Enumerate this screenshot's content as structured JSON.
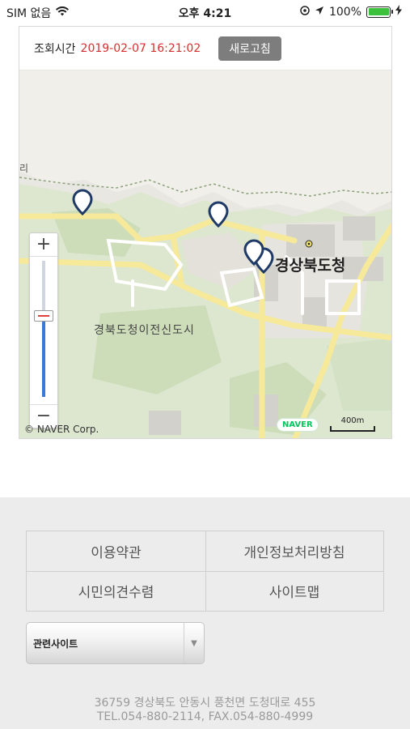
{
  "status_bar": {
    "carrier": "SIM 없음",
    "time": "오후 4:21",
    "battery": "100%",
    "icons": [
      "wifi-icon",
      "location-lock-icon",
      "location-arrow-icon",
      "battery-icon",
      "charging-icon"
    ]
  },
  "map_card": {
    "query_label": "조회시간",
    "query_time": "2019-02-07 16:21:02",
    "refresh_label": "새로고침",
    "map": {
      "big_label": "경상북도청",
      "area_label": "경북도청이전신도시",
      "edge_label": "리",
      "copyright": "© NAVER Corp.",
      "logo": "NAVER",
      "scale_label": "400m",
      "zoom_plus": "+",
      "zoom_minus": "−",
      "zoom_level": 0.6,
      "marker_count": 4
    }
  },
  "footer": {
    "links": [
      "이용약관",
      "개인정보처리방침",
      "시민의견수렴",
      "사이트맵"
    ],
    "related_select": {
      "selected": "관련사이트"
    },
    "address": "36759 경상북도 안동시 풍천면 도청대로 455",
    "contact": "TEL.054-880-2114, FAX.054-880-4999"
  },
  "colors": {
    "query_time": "#d83030",
    "refresh_bg": "#7d7d7d",
    "marker": "#1f3a66",
    "naver_green": "#03c75a",
    "zoom_track": "#3b78d8"
  }
}
